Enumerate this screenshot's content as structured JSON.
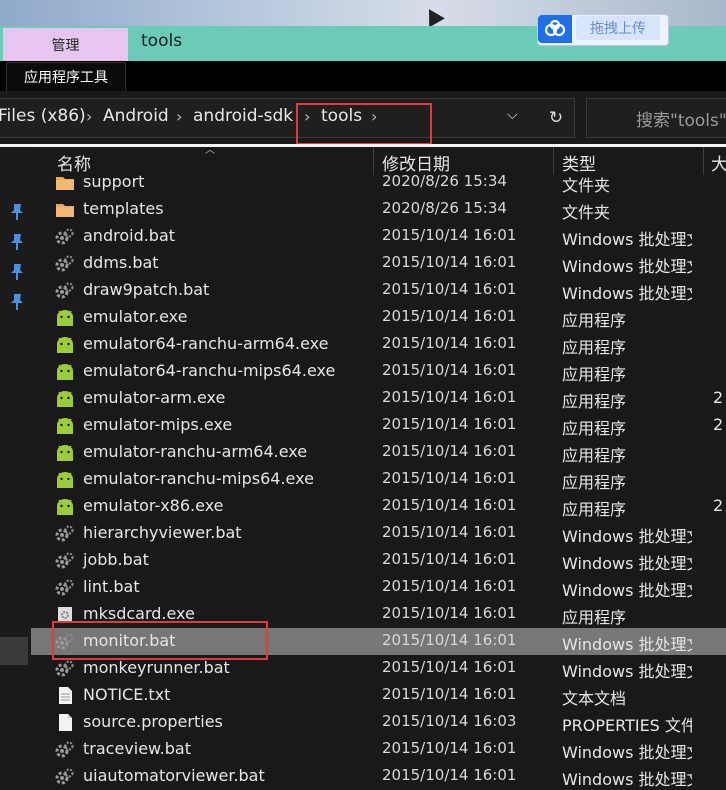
{
  "window": {
    "manage_tab": "管理",
    "title": "tools",
    "app_tools_tab": "应用程序工具",
    "upload_label": "拖拽上传"
  },
  "address": {
    "crumbs": [
      "Files (x86)",
      "Android",
      "android-sdk",
      "tools"
    ],
    "search_placeholder": "搜索\"tools\""
  },
  "columns": {
    "name": "名称",
    "date": "修改日期",
    "type": "类型",
    "size": "大"
  },
  "files": [
    {
      "name": "support",
      "date": "2020/8/26 15:34",
      "type": "文件夹",
      "size": "",
      "icon": "folder-icon"
    },
    {
      "name": "templates",
      "date": "2020/8/26 15:34",
      "type": "文件夹",
      "size": "",
      "icon": "folder-icon"
    },
    {
      "name": "android.bat",
      "date": "2015/10/14 16:01",
      "type": "Windows 批处理文件",
      "size": "",
      "icon": "gear-file-icon"
    },
    {
      "name": "ddms.bat",
      "date": "2015/10/14 16:01",
      "type": "Windows 批处理文件",
      "size": "",
      "icon": "gear-file-icon"
    },
    {
      "name": "draw9patch.bat",
      "date": "2015/10/14 16:01",
      "type": "Windows 批处理文件",
      "size": "",
      "icon": "gear-file-icon"
    },
    {
      "name": "emulator.exe",
      "date": "2015/10/14 16:01",
      "type": "应用程序",
      "size": "",
      "icon": "android-icon"
    },
    {
      "name": "emulator64-ranchu-arm64.exe",
      "date": "2015/10/14 16:01",
      "type": "应用程序",
      "size": "",
      "icon": "android-icon"
    },
    {
      "name": "emulator64-ranchu-mips64.exe",
      "date": "2015/10/14 16:01",
      "type": "应用程序",
      "size": "",
      "icon": "android-icon"
    },
    {
      "name": "emulator-arm.exe",
      "date": "2015/10/14 16:01",
      "type": "应用程序",
      "size": "2",
      "icon": "android-icon"
    },
    {
      "name": "emulator-mips.exe",
      "date": "2015/10/14 16:01",
      "type": "应用程序",
      "size": "2",
      "icon": "android-icon"
    },
    {
      "name": "emulator-ranchu-arm64.exe",
      "date": "2015/10/14 16:01",
      "type": "应用程序",
      "size": "",
      "icon": "android-icon"
    },
    {
      "name": "emulator-ranchu-mips64.exe",
      "date": "2015/10/14 16:01",
      "type": "应用程序",
      "size": "",
      "icon": "android-icon"
    },
    {
      "name": "emulator-x86.exe",
      "date": "2015/10/14 16:01",
      "type": "应用程序",
      "size": "2",
      "icon": "android-icon"
    },
    {
      "name": "hierarchyviewer.bat",
      "date": "2015/10/14 16:01",
      "type": "Windows 批处理文件",
      "size": "",
      "icon": "gear-file-icon"
    },
    {
      "name": "jobb.bat",
      "date": "2015/10/14 16:01",
      "type": "Windows 批处理文件",
      "size": "",
      "icon": "gear-file-icon"
    },
    {
      "name": "lint.bat",
      "date": "2015/10/14 16:01",
      "type": "Windows 批处理文件",
      "size": "",
      "icon": "gear-file-icon"
    },
    {
      "name": "mksdcard.exe",
      "date": "2015/10/14 16:01",
      "type": "应用程序",
      "size": "",
      "icon": "exe-icon"
    },
    {
      "name": "monitor.bat",
      "date": "2015/10/14 16:01",
      "type": "Windows 批处理文件",
      "size": "",
      "icon": "gear-file-icon",
      "selected": true
    },
    {
      "name": "monkeyrunner.bat",
      "date": "2015/10/14 16:01",
      "type": "Windows 批处理文件",
      "size": "",
      "icon": "gear-file-icon"
    },
    {
      "name": "NOTICE.txt",
      "date": "2015/10/14 16:01",
      "type": "文本文档",
      "size": "",
      "icon": "text-file-icon"
    },
    {
      "name": "source.properties",
      "date": "2015/10/14 16:03",
      "type": "PROPERTIES 文件",
      "size": "",
      "icon": "blank-file-icon"
    },
    {
      "name": "traceview.bat",
      "date": "2015/10/14 16:01",
      "type": "Windows 批处理文件",
      "size": "",
      "icon": "gear-file-icon"
    },
    {
      "name": "uiautomatorviewer.bat",
      "date": "2015/10/14 16:01",
      "type": "Windows 批处理文件",
      "size": "",
      "icon": "gear-file-icon"
    }
  ],
  "colors": {
    "ribbon": "#6ccbb7",
    "manage_tab": "#e6c6f0",
    "highlight": "#e03a3a",
    "selected_row": "#777777",
    "android_green": "#9ccc3c",
    "folder": "#e8a860"
  }
}
